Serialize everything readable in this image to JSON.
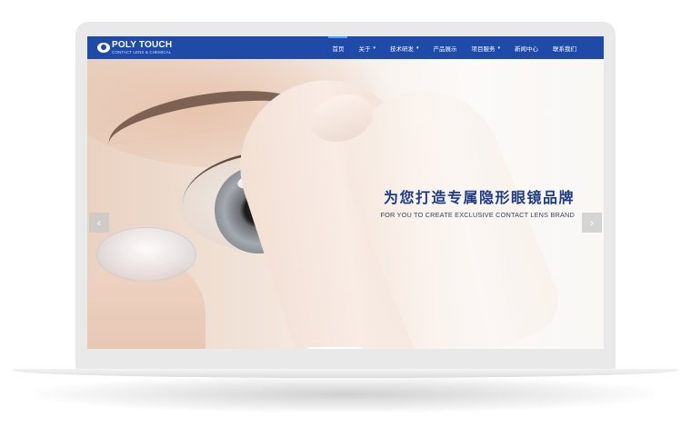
{
  "site": {
    "logo": {
      "title": "POLY TOUCH",
      "subtitle": "CONTACT LENS & CHEMICAL"
    },
    "nav": [
      {
        "label": "首页",
        "active": true,
        "dropdown": false
      },
      {
        "label": "关于",
        "active": false,
        "dropdown": true
      },
      {
        "label": "技术研发",
        "active": false,
        "dropdown": true
      },
      {
        "label": "产品展示",
        "active": false,
        "dropdown": false
      },
      {
        "label": "项目服务",
        "active": false,
        "dropdown": true
      },
      {
        "label": "新闻中心",
        "active": false,
        "dropdown": false
      },
      {
        "label": "联系我们",
        "active": false,
        "dropdown": false
      }
    ],
    "hero": {
      "title": "为您打造专属隐形眼镜品牌",
      "subtitle": "FOR YOU TO CREATE EXCLUSIVE CONTACT LENS BRAND",
      "prev_icon": "chevron-left-icon",
      "next_icon": "chevron-right-icon",
      "slide_count": 2,
      "active_slide": 2
    },
    "colors": {
      "nav_bg": "#1f4aa8",
      "nav_active_indicator": "#4fa3ff",
      "hero_title": "#1d3b84",
      "pagination_active": "#2c89e6"
    }
  }
}
